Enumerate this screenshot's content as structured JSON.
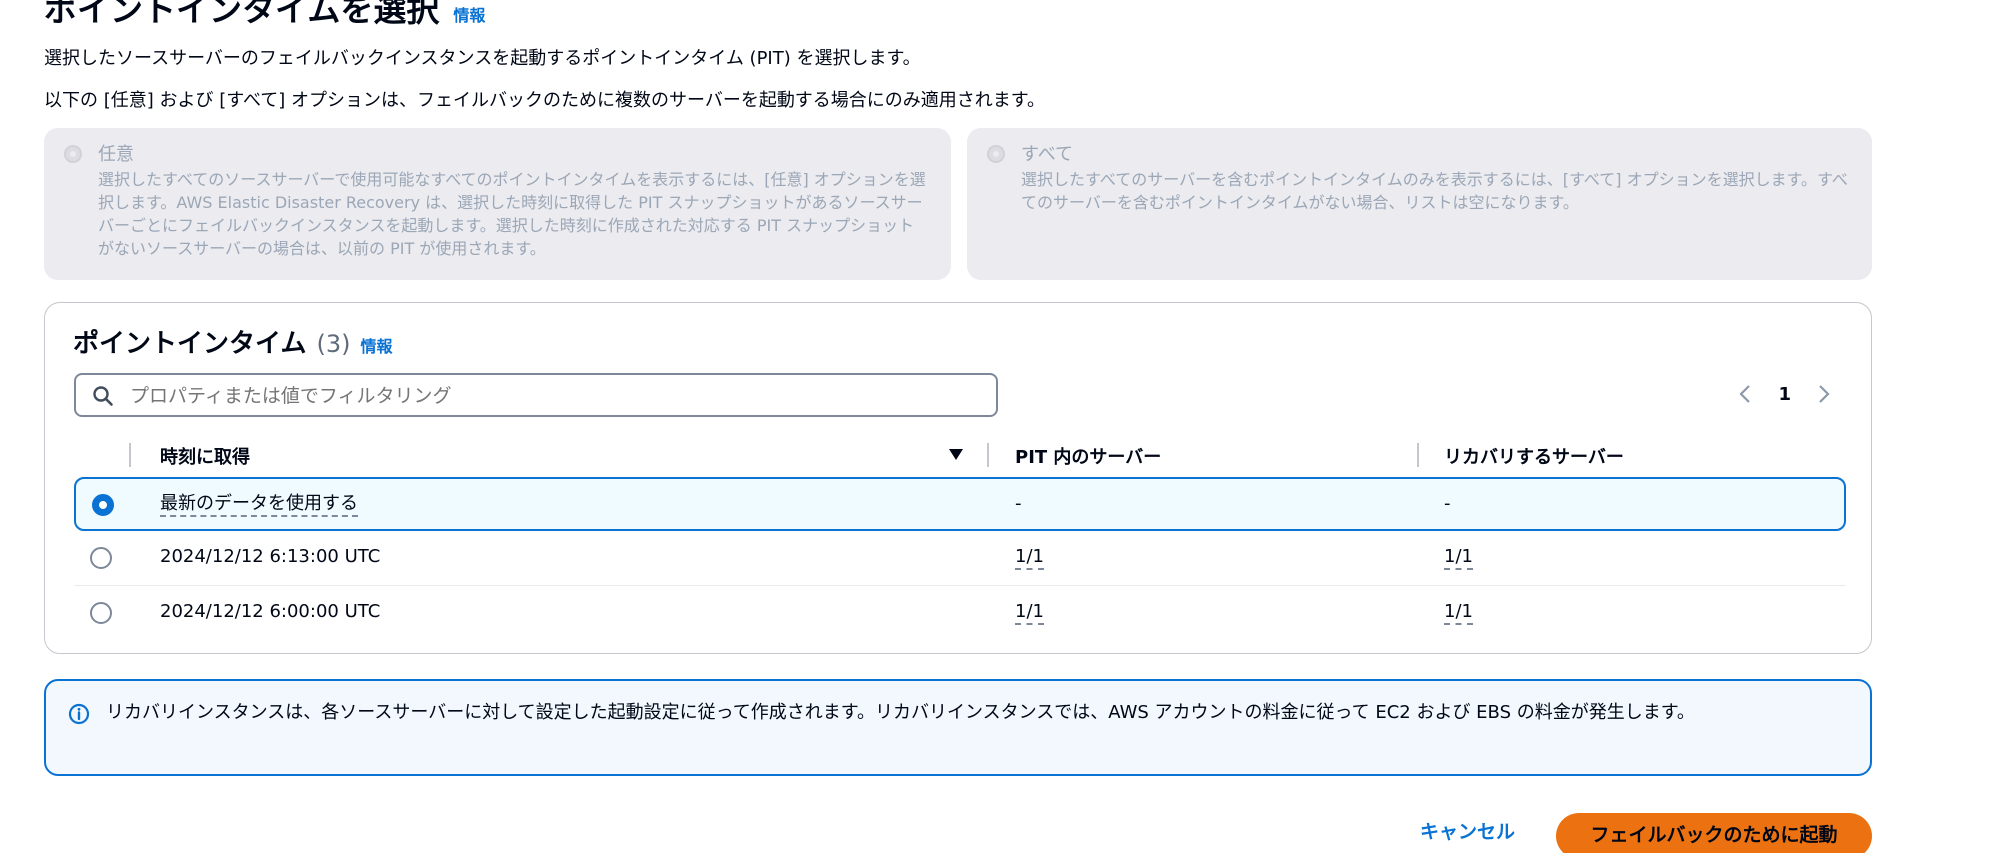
{
  "header": {
    "title": "ポイントインタイムを選択",
    "info_link": "情報",
    "description_1": "選択したソースサーバーのフェイルバックインスタンスを起動するポイントインタイム (PIT) を選択します。",
    "description_2": "以下の [任意] および [すべて] オプションは、フェイルバックのために複数のサーバーを起動する場合にのみ適用されます。"
  },
  "options": {
    "any": {
      "label": "任意",
      "description": "選択したすべてのソースサーバーで使用可能なすべてのポイントインタイムを表示するには、[任意] オプションを選択します。AWS Elastic Disaster Recovery は、選択した時刻に取得した PIT スナップショットがあるソースサーバーごとにフェイルバックインスタンスを起動します。選択した時刻に作成された対応する PIT スナップショットがないソースサーバーの場合は、以前の PIT が使用されます。",
      "disabled": true
    },
    "all": {
      "label": "すべて",
      "description": "選択したすべてのサーバーを含むポイントインタイムのみを表示するには、[すべて] オプションを選択します。すべてのサーバーを含むポイントインタイムがない場合、リストは空になります。",
      "disabled": true
    }
  },
  "table": {
    "title": "ポイントインタイム",
    "count": "(3)",
    "info_link": "情報",
    "filter_placeholder": "プロパティまたは値でフィルタリング",
    "current_page": "1",
    "columns": [
      "時刻に取得",
      "PIT 内のサーバー",
      "リカバリするサーバー"
    ],
    "sort_icon": "caret-down-filled-icon",
    "rows": [
      {
        "taken": "最新のデータを使用する",
        "servers_in_pit": "-",
        "servers_to_recover": "-",
        "selected": true
      },
      {
        "taken": "2024/12/12 6:13:00 UTC",
        "servers_in_pit": "1/1",
        "servers_to_recover": "1/1",
        "selected": false
      },
      {
        "taken": "2024/12/12 6:00:00 UTC",
        "servers_in_pit": "1/1",
        "servers_to_recover": "1/1",
        "selected": false
      }
    ]
  },
  "alert": {
    "icon": "info-circle-icon",
    "text": "リカバリインスタンスは、各ソースサーバーに対して設定した起動設定に従って作成されます。リカバリインスタンスでは、AWS アカウントの料金に従って EC2 および EBS の料金が発生します。"
  },
  "footer": {
    "cancel_label": "キャンセル",
    "primary_label": "フェイルバックのために起動"
  },
  "colors": {
    "accent": "#0972d3",
    "primary_button": "#ec7211",
    "tile_background": "#ebebf0",
    "alert_background": "#f2f8fd"
  }
}
